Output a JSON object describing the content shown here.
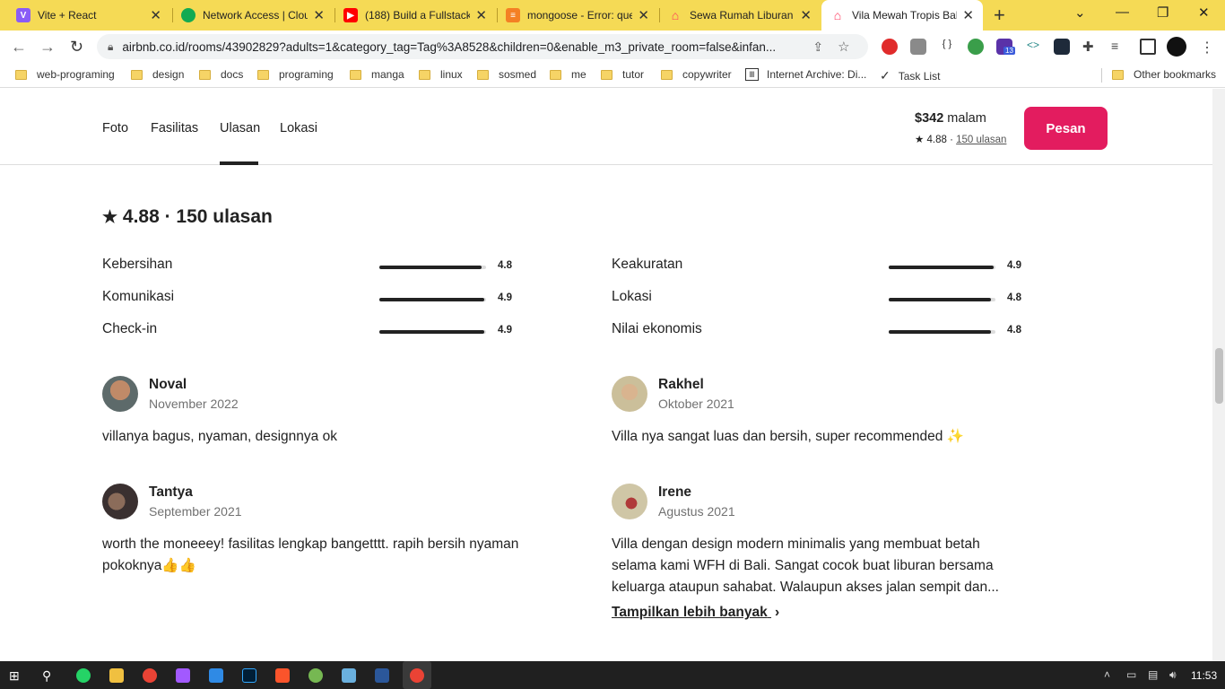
{
  "browser": {
    "tabs": [
      {
        "title": "Vite + React",
        "icon": "vite-icon",
        "color": "#8a5cf6"
      },
      {
        "title": "Network Access | Clou",
        "icon": "mongodb-leaf-icon",
        "color": "#13aa52"
      },
      {
        "title": "(188) Build a Fullstack",
        "icon": "youtube-icon",
        "color": "#ff0000"
      },
      {
        "title": "mongoose - Error: que",
        "icon": "stackoverflow-icon",
        "color": "#f48024"
      },
      {
        "title": "Sewa Rumah Liburan",
        "icon": "airbnb-icon",
        "color": "#ff385c"
      },
      {
        "title": "Vila Mewah Tropis Bal",
        "icon": "airbnb-icon",
        "color": "#ff385c"
      }
    ],
    "url": "airbnb.co.id/rooms/43902829?adults=1&category_tag=Tag%3A8528&children=0&enable_m3_private_room=false&infan...",
    "bookmarks": [
      "web-programing",
      "design",
      "docs",
      "programing",
      "manga",
      "linux",
      "sosmed",
      "me",
      "tutor",
      "copywriter",
      "Internet Archive: Di...",
      "Task List"
    ],
    "other_bookmarks": "Other bookmarks",
    "extension_badge": "13"
  },
  "subnav": {
    "items": [
      "Foto",
      "Fasilitas",
      "Ulasan",
      "Lokasi"
    ],
    "price": "$342",
    "per_night": "malam",
    "rating": "4.88",
    "reviews_link": "150 ulasan",
    "book_label": "Pesan"
  },
  "reviews": {
    "heading": "4.88 · 150 ulasan",
    "categories": [
      {
        "label": "Kebersihan",
        "score": "4.8",
        "fraction": 0.96
      },
      {
        "label": "Komunikasi",
        "score": "4.9",
        "fraction": 0.98
      },
      {
        "label": "Check-in",
        "score": "4.9",
        "fraction": 0.98
      },
      {
        "label": "Keakuratan",
        "score": "4.9",
        "fraction": 0.98
      },
      {
        "label": "Lokasi",
        "score": "4.8",
        "fraction": 0.96
      },
      {
        "label": "Nilai ekonomis",
        "score": "4.8",
        "fraction": 0.96
      }
    ],
    "items": [
      {
        "name": "Noval",
        "date": "November 2022",
        "text": "villanya bagus, nyaman, designnya ok"
      },
      {
        "name": "Rakhel",
        "date": "Oktober 2021",
        "text": "Villa nya sangat luas dan bersih, super recommended ✨"
      },
      {
        "name": "Tantya",
        "date": "September 2021",
        "text": "worth the moneeey! fasilitas lengkap bangetttt. rapih bersih nyaman pokoknya👍👍"
      },
      {
        "name": "Irene",
        "date": "Agustus 2021",
        "text": "Villa dengan design modern minimalis yang membuat betah selama kami WFH di Bali. Sangat cocok buat liburan bersama keluarga ataupun sahabat. Walaupun akses jalan sempit dan..."
      }
    ],
    "show_more": "Tampilkan lebih banyak"
  },
  "taskbar": {
    "time": "11:53"
  }
}
